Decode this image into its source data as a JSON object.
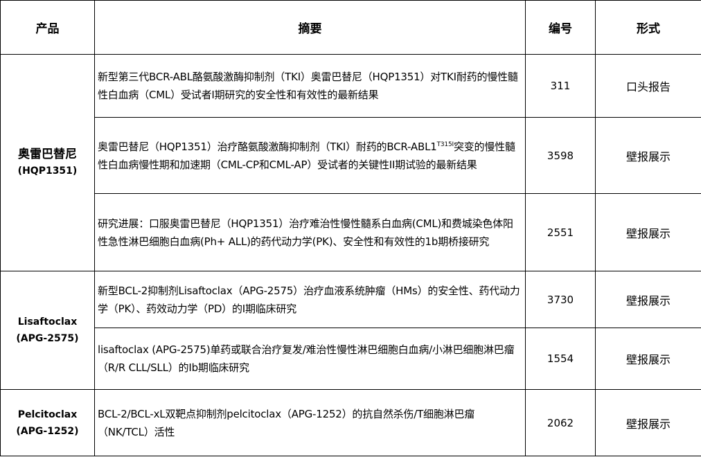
{
  "headers": {
    "product": "产品",
    "summary": "摘要",
    "number": "编号",
    "format": "形式"
  },
  "groups": [
    {
      "product_name": "奥雷巴替尼",
      "product_code": "(HQP1351)",
      "rows": [
        {
          "summary": "新型第三代BCR-ABL酪氨酸激酶抑制剂（TKI）奥雷巴替尼（HQP1351）对TKI耐药的慢性髓性白血病（CML）受试者I期研究的安全性和有效性的最新结果",
          "number": "311",
          "format": "口头报告"
        },
        {
          "summary_pre": "奥雷巴替尼（HQP1351）治疗酪氨酸激酶抑制剂（TKI）耐药的BCR-ABL1",
          "summary_sup": "T315I",
          "summary_post": "突变的慢性髓性白血病慢性期和加速期（CML-CP和CML-AP）受试者的关键性II期试验的最新结果",
          "number": "3598",
          "format": "壁报展示"
        },
        {
          "summary": "研究进展：口服奥雷巴替尼（HQP1351）治疗难治性慢性髓系白血病(CML)和费城染色体阳性急性淋巴细胞白血病(Ph+ ALL)的药代动力学(PK)、安全性和有效性的1b期桥接研究",
          "number": "2551",
          "format": "壁报展示"
        }
      ]
    },
    {
      "product_name": "Lisaftoclax",
      "product_code": "(APG-2575)",
      "rows": [
        {
          "summary": "新型BCL-2抑制剂Lisaftoclax（APG-2575）治疗血液系统肿瘤（HMs）的安全性、药代动力学（PK）、药效动力学（PD）的I期临床研究",
          "number": "3730",
          "format": "壁报展示"
        },
        {
          "summary": "lisaftoclax (APG-2575)单药或联合治疗复发/难治性慢性淋巴细胞白血病/小淋巴细胞淋巴瘤（R/R CLL/SLL）的Ib期临床研究",
          "number": "1554",
          "format": "壁报展示"
        }
      ]
    },
    {
      "product_name": "Pelcitoclax",
      "product_code": "(APG-1252)",
      "rows": [
        {
          "summary": "BCL-2/BCL-xL双靶点抑制剂pelcitoclax（APG-1252）的抗自然杀伤/T细胞淋巴瘤（NK/TCL）活性",
          "number": "2062",
          "format": "壁报展示"
        }
      ]
    }
  ]
}
